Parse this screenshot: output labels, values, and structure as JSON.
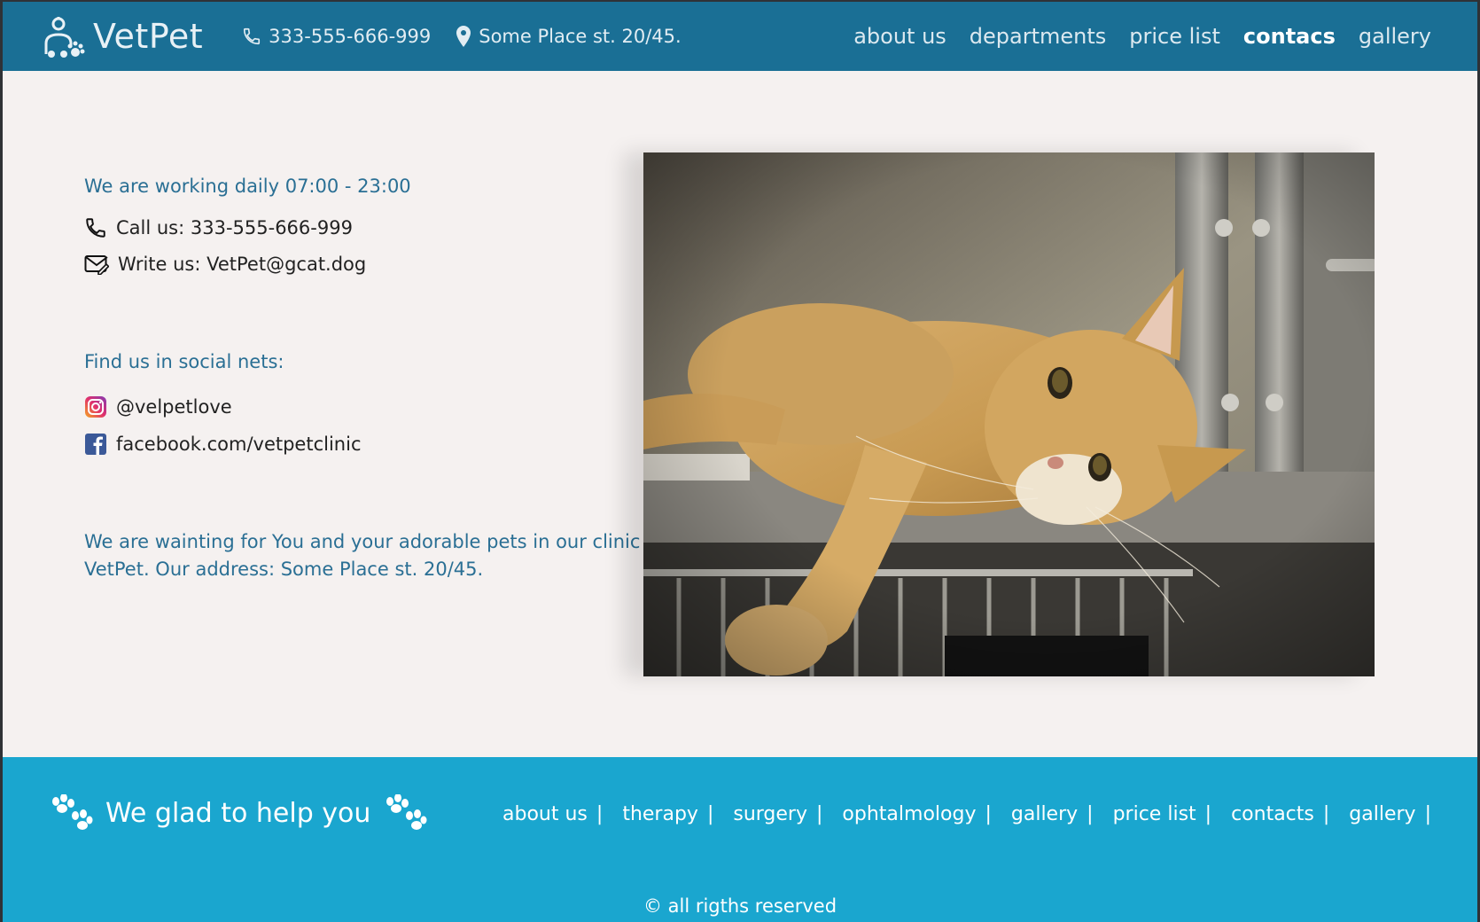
{
  "header": {
    "logo_text": "VetPet",
    "phone": "333-555-666-999",
    "address": "Some Place st. 20/45.",
    "nav": [
      "about us",
      "departments",
      "price list",
      "contacs",
      "gallery"
    ],
    "active_nav": "contacs"
  },
  "main": {
    "hours": "We are working daily 07:00 - 23:00",
    "call_label": "Call us: 333-555-666-999",
    "write_label": "Write us: VetPet@gcat.dog",
    "social_heading": "Find us in social nets:",
    "instagram": "@velpetlove",
    "facebook": "facebook.com/vetpetclinic",
    "closing_line1": "We are wainting for You and your adorable pets in our clinic",
    "closing_line2": "VetPet. Our address: Some Place st. 20/45."
  },
  "footer": {
    "slogan": "We glad to help you",
    "links": [
      "about us",
      "therapy",
      "surgery",
      "ophtalmology",
      "gallery",
      "price list",
      "contacts",
      "gallery"
    ],
    "separator": "|",
    "copyright": "© all rigths reserved"
  },
  "colors": {
    "header_bg": "#1a6f95",
    "footer_bg": "#1aa6cf",
    "page_bg": "#f5f1f0",
    "accent_text": "#2a6f94"
  },
  "icons": [
    "vet-logo-icon",
    "phone-icon",
    "location-pin-icon",
    "mail-icon",
    "instagram-icon",
    "facebook-icon",
    "paw-icon"
  ]
}
